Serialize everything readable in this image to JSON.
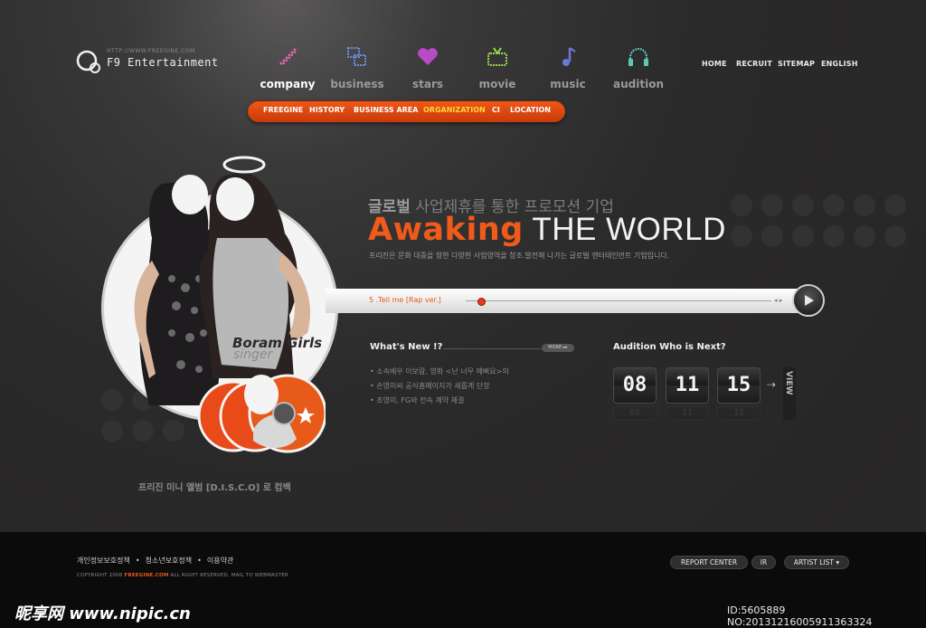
{
  "logo": {
    "url": "HTTP://WWW.FREEGINE.COM",
    "name": "F9 Entertainment"
  },
  "nav": [
    {
      "label": "company",
      "icon": "pencil-icon",
      "active": true
    },
    {
      "label": "business",
      "icon": "squares-icon"
    },
    {
      "label": "stars",
      "icon": "heart-icon"
    },
    {
      "label": "movie",
      "icon": "tv-icon"
    },
    {
      "label": "music",
      "icon": "music-note-icon"
    },
    {
      "label": "audition",
      "icon": "headphones-icon"
    }
  ],
  "util": [
    "HOME",
    "RECRUIT",
    "SITEMAP",
    "ENGLISH"
  ],
  "submenu": [
    "FREEGINE",
    "HISTORY",
    "BUSINESS AREA",
    "ORGANIZATION",
    "CI",
    "LOCATION"
  ],
  "submenu_active": "ORGANIZATION",
  "hero": {
    "heading_kr_bold": "글로벌",
    "heading_kr": " 사업제휴를 통한 프로모션 기업",
    "headline_accent": "Awaking",
    "headline_rest": " THE WORLD",
    "tagline": "프리진은 문화 대중을 향한 다양한 사업영역을 창조.발전해 나가는 글로벌 엔터테인먼트 기업입니다.",
    "badge_line1": "Boram Girls",
    "badge_line2": "singer"
  },
  "player": {
    "track": "5 .Tell me [Rap ver.]",
    "progress": 0.05,
    "controls": "◂ ▸"
  },
  "whats_new": {
    "title": "What's New !?",
    "more": "MORE ▸▸",
    "items": [
      "• 소속배우 이보람, 영화 <난 너무 예뻐요>의",
      "• 손영미씨 공식홈페이지가 새롭게 단장",
      "• 조영미, FG와 전속 계약 체결"
    ]
  },
  "audition": {
    "title": "Audition Who is Next?",
    "digits": [
      "08",
      "11",
      "15"
    ],
    "view": "VIEW"
  },
  "album_caption": "프리진 미니 앨범  [D.I.S.C.O] 로 컴백",
  "footer": {
    "links": [
      "개인정보보호정책",
      "청소년보호정책",
      "이용약관"
    ],
    "copy_prefix": "COPYRIGHT 2008 ",
    "copy_brand": "FREEGINE.COM",
    "copy_suffix": " ALL RIGHT RESERVED. MAIL TO WEBMASTER",
    "buttons": [
      "REPORT CENTER",
      "IR",
      "ARTIST LIST ▾"
    ]
  },
  "watermark": {
    "left": "昵享网 www.nipic.cn",
    "right": "ID:5605889 NO:20131216005911363324"
  },
  "colors": {
    "accent": "#f05a1a",
    "highlight": "#ffd43a",
    "background": "#2b2a2a"
  }
}
